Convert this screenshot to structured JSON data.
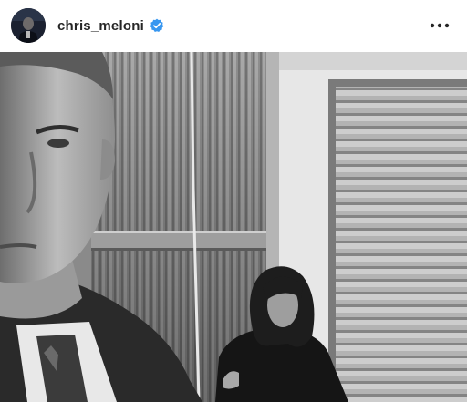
{
  "header": {
    "username": "chris_meloni",
    "verified": true,
    "avatar": "profile-avatar",
    "more_icon": "more-horizontal-icon"
  },
  "post": {
    "photo": "black-and-white-selfie-photo",
    "icons": {
      "verified": "verified-badge-icon"
    },
    "colors": {
      "verified_blue": "#3897f0",
      "text": "#262626"
    }
  }
}
